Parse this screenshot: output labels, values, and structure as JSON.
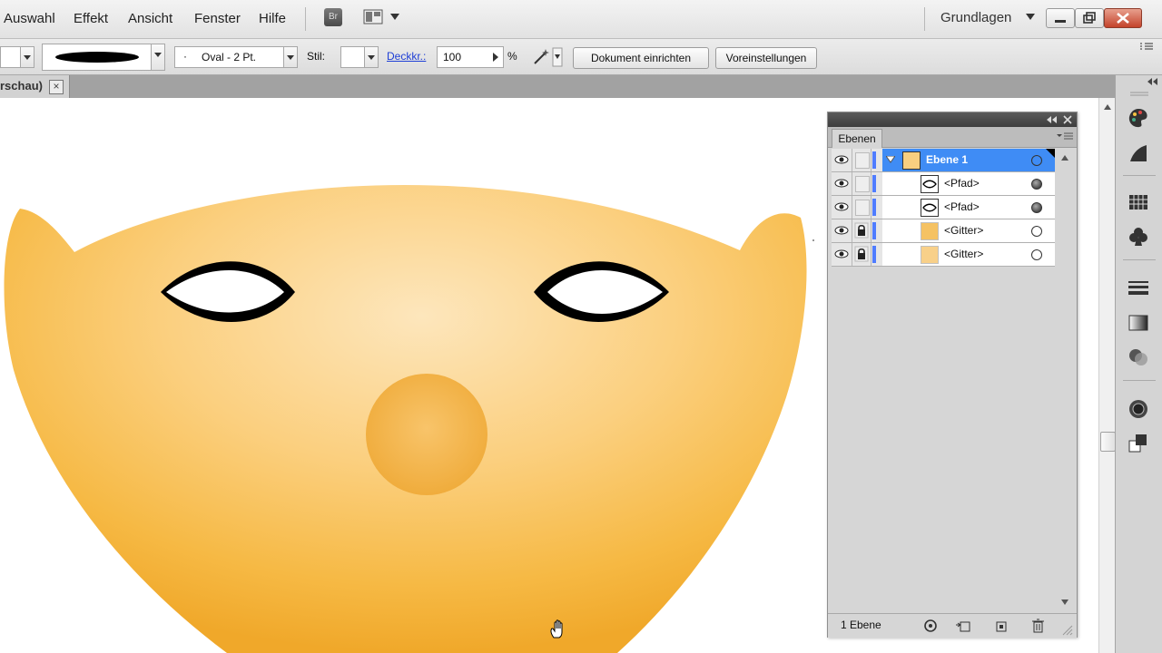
{
  "menu": {
    "items": [
      "Auswahl",
      "Effekt",
      "Ansicht",
      "Fenster",
      "Hilfe"
    ],
    "bridge_label": "Br",
    "workspace": "Grundlagen"
  },
  "control": {
    "brush_style": "Oval - 2 Pt.",
    "brush_dot": "·",
    "stil_label": "Stil:",
    "opacity_label": "Deckkr.:",
    "opacity_value": "100",
    "percent": "%",
    "doc_setup": "Dokument einrichten",
    "preferences": "Voreinstellungen"
  },
  "doc_tab": {
    "title": "rschau)",
    "close": "×"
  },
  "layers_panel": {
    "tab": "Ebenen",
    "rows": [
      {
        "label": "Ebene 1",
        "selected": true
      },
      {
        "label": "<Pfad>"
      },
      {
        "label": "<Pfad>"
      },
      {
        "label": "<Gitter>"
      },
      {
        "label": "<Gitter>"
      }
    ],
    "footer": "1 Ebene"
  },
  "colors": {
    "face_light": "#fde3b4",
    "face_dark": "#f0a82a",
    "selection": "#3f8cf5",
    "layer_color": "#4f7cff"
  },
  "icons": [
    "eye-icon",
    "lock-icon",
    "hand-icon",
    "close-icon",
    "minimize-icon",
    "restore-icon",
    "arrange-icon",
    "chevron-down-icon"
  ]
}
